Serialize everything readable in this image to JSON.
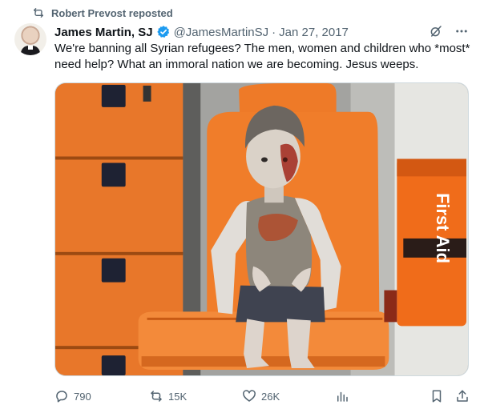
{
  "repost": {
    "text": "Robert Prevost reposted",
    "icon": "repost-icon"
  },
  "author": {
    "name": "James Martin, SJ",
    "handle": "@JamesMartinSJ",
    "separator": "·",
    "date": "Jan 27, 2017",
    "verified": true
  },
  "tweet": {
    "text": "We're banning all Syrian refugees? The men, women and children who *most* need help? What an immoral nation we are becoming. Jesus weeps."
  },
  "media": {
    "sign_text": "First Aid",
    "colors": {
      "orange": "#f07d2a",
      "dark_orange": "#c85a14",
      "gray": "#9a9a98"
    }
  },
  "actions": {
    "replies": "790",
    "reposts": "15K",
    "likes": "26K"
  },
  "colors": {
    "accent": "#1d9bf0",
    "muted": "#536471",
    "text": "#0f1419"
  }
}
